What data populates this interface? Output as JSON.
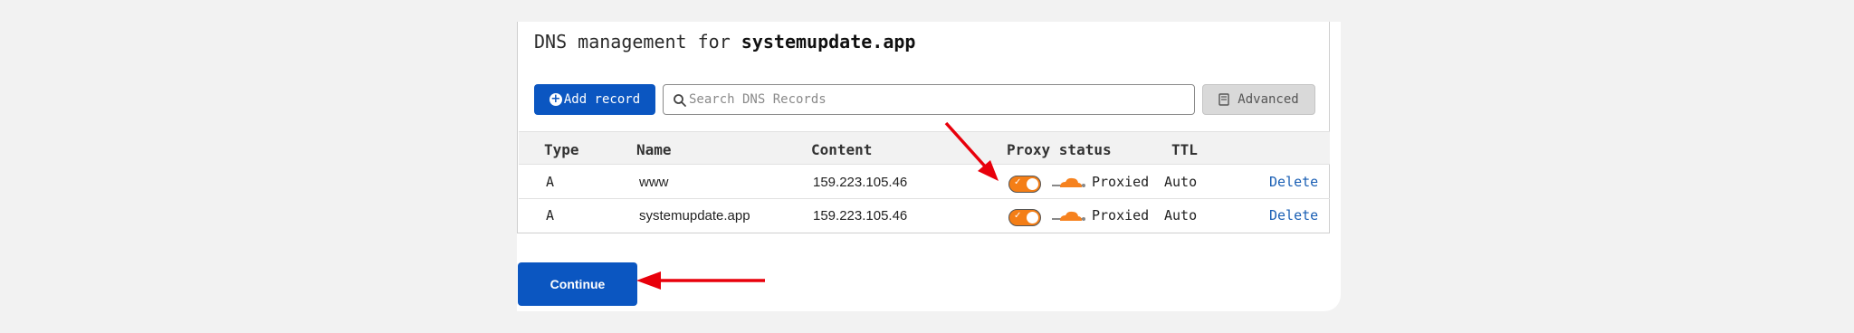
{
  "page": {
    "title_prefix": "DNS management for",
    "domain": "systemupdate.app"
  },
  "toolbar": {
    "add_record_label": "Add record",
    "search_placeholder": "Search DNS Records",
    "search_value": "",
    "advanced_label": "Advanced"
  },
  "table": {
    "headers": {
      "type": "Type",
      "name": "Name",
      "content": "Content",
      "proxy_status": "Proxy status",
      "ttl": "TTL"
    },
    "rows": [
      {
        "type": "A",
        "name": "www",
        "content": "159.223.105.46",
        "proxy_status": "Proxied",
        "proxy_on": true,
        "ttl": "Auto",
        "action": "Delete"
      },
      {
        "type": "A",
        "name": "systemupdate.app",
        "content": "159.223.105.46",
        "proxy_status": "Proxied",
        "proxy_on": true,
        "ttl": "Auto",
        "action": "Delete"
      }
    ]
  },
  "continue_label": "Continue",
  "colors": {
    "primary": "#0b56c1",
    "proxy_orange": "#f47e16",
    "annotation_red": "#e8000b",
    "link_blue": "#1a5fb4"
  },
  "icons": {
    "add": "plus-circle-icon",
    "search": "search-icon",
    "advanced": "book-icon",
    "proxy": "cloud-icon"
  }
}
